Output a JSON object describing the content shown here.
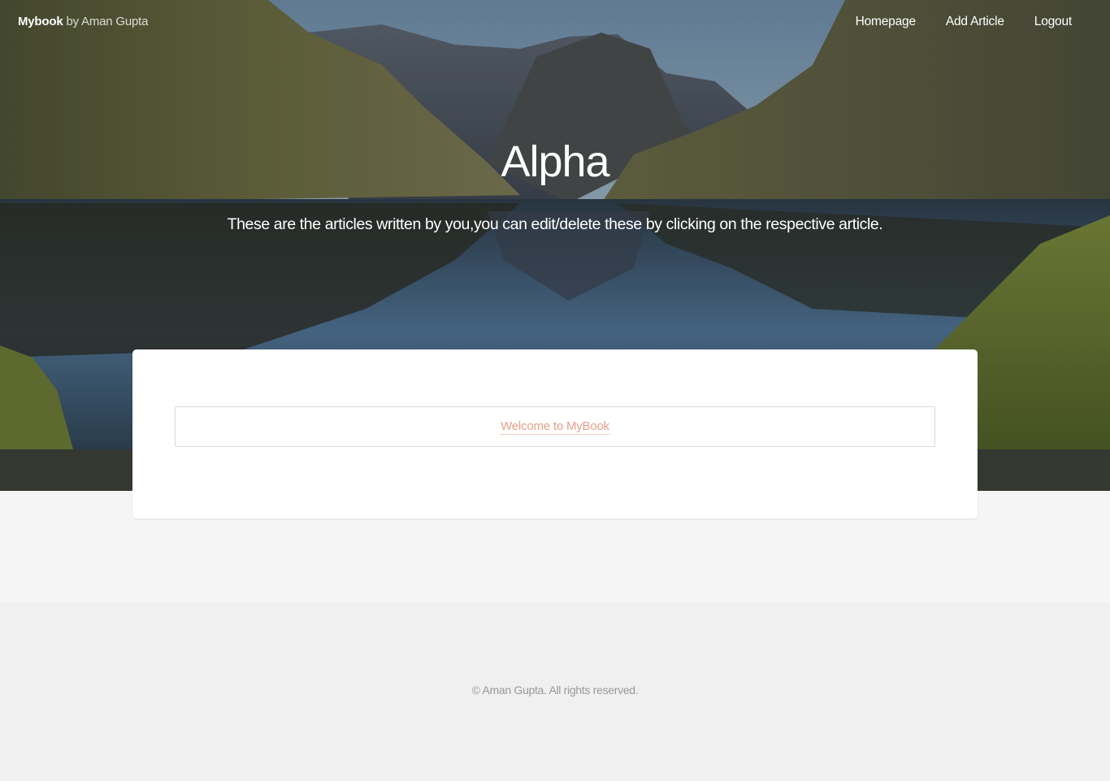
{
  "header": {
    "brand": "Mybook",
    "byline": "by Aman Gupta",
    "nav": [
      {
        "label": "Homepage"
      },
      {
        "label": "Add Article"
      },
      {
        "label": "Logout"
      }
    ]
  },
  "hero": {
    "title": "Alpha",
    "subtitle": "These are the articles written by you,you can edit/delete these by clicking on the respective article."
  },
  "articles": [
    {
      "title": "Welcome to MyBook"
    }
  ],
  "footer": {
    "copyright": "© Aman Gupta. All rights reserved."
  },
  "colors": {
    "link": "#e8a08a",
    "footer_bg": "#f0f0f0",
    "page_bg": "#f5f5f5"
  }
}
